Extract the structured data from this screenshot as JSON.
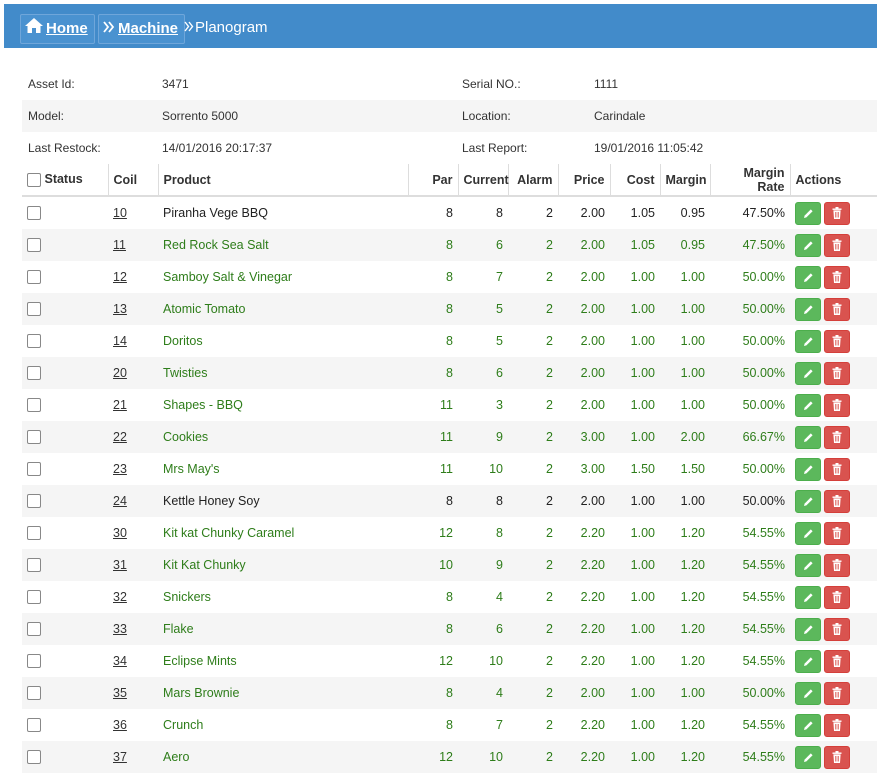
{
  "breadcrumb": {
    "home": "Home",
    "machine": "Machine",
    "current": "Planogram"
  },
  "info": {
    "asset_id_label": "Asset Id:",
    "asset_id": "3471",
    "serial_label": "Serial NO.:",
    "serial": "1111",
    "model_label": "Model:",
    "model": "Sorrento 5000",
    "location_label": "Location:",
    "location": "Carindale",
    "last_restock_label": "Last Restock:",
    "last_restock": "14/01/2016 20:17:37",
    "last_report_label": "Last Report:",
    "last_report": "19/01/2016 11:05:42"
  },
  "table": {
    "headers": {
      "status": "Status",
      "coil": "Coil",
      "product": "Product",
      "par": "Par",
      "current": "Current",
      "alarm": "Alarm",
      "price": "Price",
      "cost": "Cost",
      "margin": "Margin",
      "margin_rate": "Margin Rate",
      "actions": "Actions"
    },
    "rows": [
      {
        "coil": "10",
        "product": "Piranha Vege BBQ",
        "par": "8",
        "current": "8",
        "alarm": "2",
        "price": "2.00",
        "cost": "1.05",
        "margin": "0.95",
        "rate": "47.50%",
        "color": "black"
      },
      {
        "coil": "11",
        "product": "Red Rock Sea Salt",
        "par": "8",
        "current": "6",
        "alarm": "2",
        "price": "2.00",
        "cost": "1.05",
        "margin": "0.95",
        "rate": "47.50%",
        "color": "green"
      },
      {
        "coil": "12",
        "product": "Samboy Salt & Vinegar",
        "par": "8",
        "current": "7",
        "alarm": "2",
        "price": "2.00",
        "cost": "1.00",
        "margin": "1.00",
        "rate": "50.00%",
        "color": "green"
      },
      {
        "coil": "13",
        "product": "Atomic Tomato",
        "par": "8",
        "current": "5",
        "alarm": "2",
        "price": "2.00",
        "cost": "1.00",
        "margin": "1.00",
        "rate": "50.00%",
        "color": "green"
      },
      {
        "coil": "14",
        "product": "Doritos",
        "par": "8",
        "current": "5",
        "alarm": "2",
        "price": "2.00",
        "cost": "1.00",
        "margin": "1.00",
        "rate": "50.00%",
        "color": "green"
      },
      {
        "coil": "20",
        "product": "Twisties",
        "par": "8",
        "current": "6",
        "alarm": "2",
        "price": "2.00",
        "cost": "1.00",
        "margin": "1.00",
        "rate": "50.00%",
        "color": "green"
      },
      {
        "coil": "21",
        "product": "Shapes - BBQ",
        "par": "11",
        "current": "3",
        "alarm": "2",
        "price": "2.00",
        "cost": "1.00",
        "margin": "1.00",
        "rate": "50.00%",
        "color": "green"
      },
      {
        "coil": "22",
        "product": "Cookies",
        "par": "11",
        "current": "9",
        "alarm": "2",
        "price": "3.00",
        "cost": "1.00",
        "margin": "2.00",
        "rate": "66.67%",
        "color": "green"
      },
      {
        "coil": "23",
        "product": "Mrs May's",
        "par": "11",
        "current": "10",
        "alarm": "2",
        "price": "3.00",
        "cost": "1.50",
        "margin": "1.50",
        "rate": "50.00%",
        "color": "green"
      },
      {
        "coil": "24",
        "product": "Kettle Honey Soy",
        "par": "8",
        "current": "8",
        "alarm": "2",
        "price": "2.00",
        "cost": "1.00",
        "margin": "1.00",
        "rate": "50.00%",
        "color": "black"
      },
      {
        "coil": "30",
        "product": "Kit kat Chunky Caramel",
        "par": "12",
        "current": "8",
        "alarm": "2",
        "price": "2.20",
        "cost": "1.00",
        "margin": "1.20",
        "rate": "54.55%",
        "color": "green"
      },
      {
        "coil": "31",
        "product": "Kit Kat Chunky",
        "par": "10",
        "current": "9",
        "alarm": "2",
        "price": "2.20",
        "cost": "1.00",
        "margin": "1.20",
        "rate": "54.55%",
        "color": "green"
      },
      {
        "coil": "32",
        "product": "Snickers",
        "par": "8",
        "current": "4",
        "alarm": "2",
        "price": "2.20",
        "cost": "1.00",
        "margin": "1.20",
        "rate": "54.55%",
        "color": "green"
      },
      {
        "coil": "33",
        "product": "Flake",
        "par": "8",
        "current": "6",
        "alarm": "2",
        "price": "2.20",
        "cost": "1.00",
        "margin": "1.20",
        "rate": "54.55%",
        "color": "green"
      },
      {
        "coil": "34",
        "product": "Eclipse Mints",
        "par": "12",
        "current": "10",
        "alarm": "2",
        "price": "2.20",
        "cost": "1.00",
        "margin": "1.20",
        "rate": "54.55%",
        "color": "green"
      },
      {
        "coil": "35",
        "product": "Mars Brownie",
        "par": "8",
        "current": "4",
        "alarm": "2",
        "price": "2.00",
        "cost": "1.00",
        "margin": "1.00",
        "rate": "50.00%",
        "color": "green"
      },
      {
        "coil": "36",
        "product": "Crunch",
        "par": "8",
        "current": "7",
        "alarm": "2",
        "price": "2.20",
        "cost": "1.00",
        "margin": "1.20",
        "rate": "54.55%",
        "color": "green"
      },
      {
        "coil": "37",
        "product": "Aero",
        "par": "12",
        "current": "10",
        "alarm": "2",
        "price": "2.20",
        "cost": "1.00",
        "margin": "1.20",
        "rate": "54.55%",
        "color": "green"
      }
    ]
  },
  "icons": {
    "home": "home-icon",
    "machine": "double-chevron-icon",
    "edit": "pencil-icon",
    "delete": "trash-icon"
  },
  "colors": {
    "topbar": "#428bca",
    "in_stock_text": "#2e7d1a",
    "edit": "#5cb85c",
    "delete": "#d9534f"
  }
}
